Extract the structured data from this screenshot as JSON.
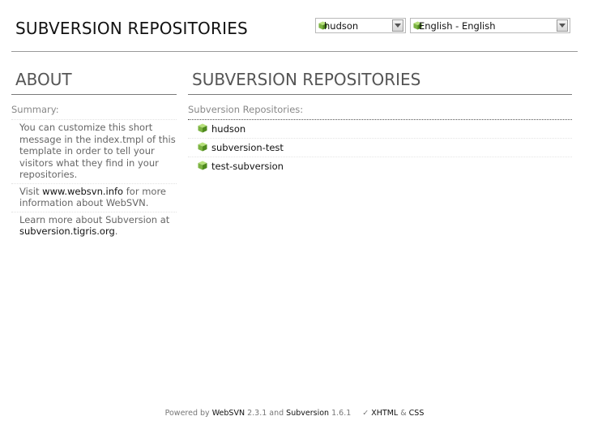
{
  "header": {
    "title": "SUBVERSION REPOSITORIES",
    "repo_select": {
      "value": "hudson"
    },
    "language_select": {
      "value": "English - English"
    }
  },
  "sidebar": {
    "heading": "ABOUT",
    "summary_label": "Summary:",
    "intro_text": "You can customize this short message in the index.tmpl of this template in order to tell your visitors what they find in your repositories.",
    "visit_prefix": "Visit ",
    "visit_link": "www.websvn.info",
    "visit_suffix": " for more information about WebSVN.",
    "learn_prefix": "Learn more about Subversion at ",
    "learn_link": "subversion.tigris.org",
    "learn_suffix": "."
  },
  "main": {
    "heading": "SUBVERSION REPOSITORIES",
    "list_label": "Subversion Repositories:",
    "repositories": [
      "hudson",
      "subversion-test",
      "test-subversion"
    ]
  },
  "footer": {
    "powered_by": "Powered by ",
    "websvn_link": "WebSVN",
    "websvn_version": " 2.3.1 and ",
    "subversion_link": "Subversion",
    "subversion_version": " 1.6.1",
    "check_mark": "✓",
    "xhtml_link": "XHTML",
    "amp": " & ",
    "css_link": "CSS"
  },
  "colors": {
    "repo_icon": "#7cb342",
    "rule": "#999999",
    "text": "#555555"
  },
  "icons": {
    "repo": "green-cube-icon",
    "dropdown": "chevron-down-icon"
  }
}
